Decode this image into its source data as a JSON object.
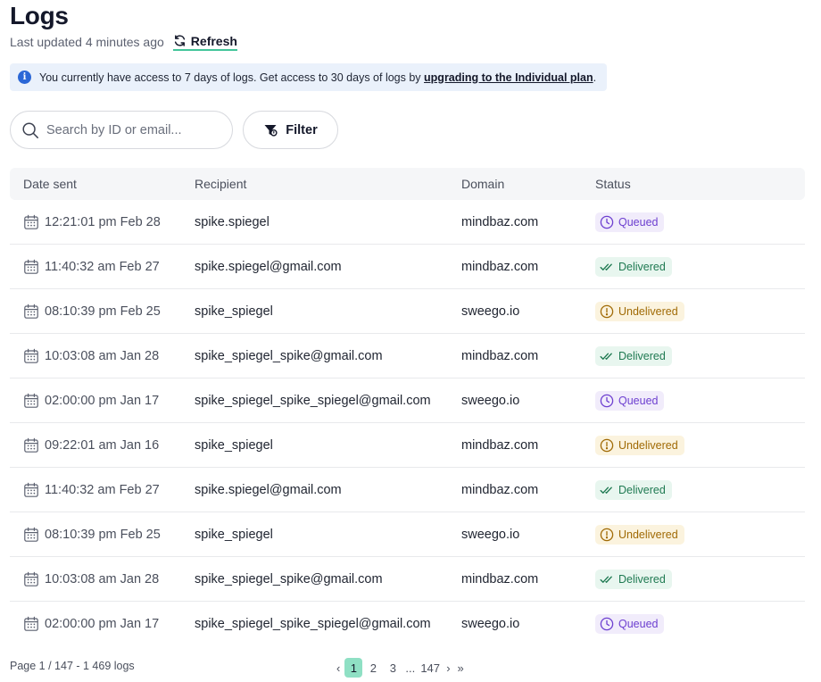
{
  "header": {
    "title": "Logs",
    "updated": "Last updated 4 minutes ago",
    "refresh_label": "Refresh"
  },
  "banner": {
    "text_before": "You currently have access to 7 days of logs. Get access to 30 days of logs by ",
    "link_text": "upgrading to the Individual plan",
    "text_after": "."
  },
  "search": {
    "placeholder": "Search by ID or email..."
  },
  "filter": {
    "label": "Filter"
  },
  "table": {
    "columns": [
      "Date sent",
      "Recipient",
      "Domain",
      "Status"
    ],
    "rows": [
      {
        "date": "12:21:01 pm Feb 28",
        "recipient": "spike.spiegel",
        "domain": "mindbaz.com",
        "status": "Queued",
        "status_type": "queued"
      },
      {
        "date": "11:40:32 am Feb 27",
        "recipient": "spike.spiegel@gmail.com",
        "domain": "mindbaz.com",
        "status": "Delivered",
        "status_type": "delivered"
      },
      {
        "date": "08:10:39 pm Feb 25",
        "recipient": "spike_spiegel",
        "domain": "sweego.io",
        "status": "Undelivered",
        "status_type": "undelivered"
      },
      {
        "date": "10:03:08 am Jan 28",
        "recipient": "spike_spiegel_spike@gmail.com",
        "domain": "mindbaz.com",
        "status": "Delivered",
        "status_type": "delivered"
      },
      {
        "date": "02:00:00 pm Jan 17",
        "recipient": "spike_spiegel_spike_spiegel@gmail.com",
        "domain": "sweego.io",
        "status": "Queued",
        "status_type": "queued"
      },
      {
        "date": "09:22:01 am Jan 16",
        "recipient": "spike_spiegel",
        "domain": "mindbaz.com",
        "status": "Undelivered",
        "status_type": "undelivered"
      },
      {
        "date": "11:40:32 am Feb 27",
        "recipient": "spike.spiegel@gmail.com",
        "domain": "mindbaz.com",
        "status": "Delivered",
        "status_type": "delivered"
      },
      {
        "date": "08:10:39 pm Feb 25",
        "recipient": "spike_spiegel",
        "domain": "sweego.io",
        "status": "Undelivered",
        "status_type": "undelivered"
      },
      {
        "date": "10:03:08 am Jan 28",
        "recipient": "spike_spiegel_spike@gmail.com",
        "domain": "mindbaz.com",
        "status": "Delivered",
        "status_type": "delivered"
      },
      {
        "date": "02:00:00 pm Jan 17",
        "recipient": "spike_spiegel_spike_spiegel@gmail.com",
        "domain": "sweego.io",
        "status": "Queued",
        "status_type": "queued"
      }
    ]
  },
  "pagination": {
    "info": "Page 1 / 147 - 1 469 logs",
    "prev": "‹",
    "pages": [
      "1",
      "2",
      "3"
    ],
    "ellipsis": "...",
    "last": "147",
    "next": "›",
    "end": "»",
    "current": "1"
  },
  "icons": {
    "refresh": "refresh-icon",
    "info": "info-icon",
    "search": "search-icon",
    "filter": "filter-icon",
    "calendar": "calendar-icon",
    "queued": "clock-icon",
    "delivered": "double-check-icon",
    "undelivered": "exclamation-circle-icon"
  },
  "colors": {
    "accent": "#43c59a",
    "active_page": "#8fe0c4",
    "info_bg": "#eaf1fb",
    "info_icon": "#2b67d6",
    "queued": "#6d3fd0",
    "delivered": "#1f7a52",
    "undelivered": "#a06a05"
  }
}
